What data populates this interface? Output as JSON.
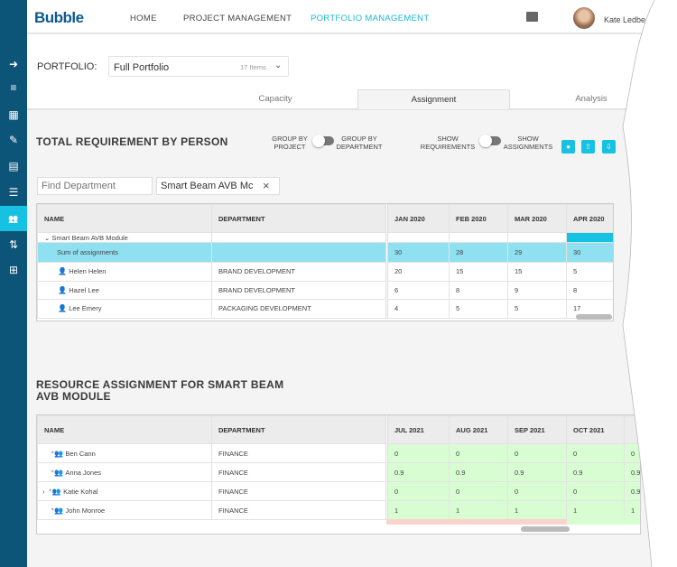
{
  "header": {
    "logo": "Bubble",
    "nav": [
      "HOME",
      "PROJECT MANAGEMENT",
      "PORTFOLIO MANAGEMENT"
    ],
    "active_nav": "PORTFOLIO MANAGEMENT",
    "user_name": "Kate Ledbe"
  },
  "sidebar": {
    "items": [
      "arrow-right-icon",
      "playlist-icon",
      "dashboard-icon",
      "edit-note-icon",
      "clipboard-icon",
      "list-icon",
      "people-icon",
      "sort-icon",
      "add-box-icon"
    ],
    "active_index": 6
  },
  "portfolio": {
    "label": "PORTFOLIO:",
    "selected": "Full Portfolio",
    "count": "17 Items"
  },
  "tabs": [
    "Capacity",
    "Assignment",
    "Analysis"
  ],
  "active_tab": "Assignment",
  "section1": {
    "title": "TOTAL REQUIREMENT BY PERSON",
    "toggle1": {
      "left": "GROUP BY PROJECT",
      "right": "GROUP BY DEPARTMENT"
    },
    "toggle2": {
      "left": "SHOW REQUIREMENTS",
      "right": "SHOW ASSIGNMENTS"
    },
    "find_placeholder": "Find Department",
    "filter_value": "Smart Beam AVB Mc",
    "columns": [
      "NAME",
      "DEPARTMENT",
      "JAN 2020",
      "FEB 2020",
      "MAR 2020",
      "APR 2020"
    ],
    "group": "Smart Beam AVB Module",
    "sum_row": {
      "name": "Sum of assignments",
      "values": [
        "30",
        "28",
        "29",
        "30"
      ]
    },
    "rows": [
      {
        "name": "Helen Helen",
        "department": "BRAND DEVELOPMENT",
        "values": [
          "20",
          "15",
          "15",
          "5"
        ]
      },
      {
        "name": "Hazel Lee",
        "department": "BRAND DEVELOPMENT",
        "values": [
          "6",
          "8",
          "9",
          "8"
        ]
      },
      {
        "name": "Lee Emery",
        "department": "PACKAGING DEVELOPMENT",
        "values": [
          "4",
          "5",
          "5",
          "17"
        ]
      }
    ]
  },
  "section2": {
    "title": "RESOURCE ASSIGNMENT FOR SMART BEAM AVB MODULE",
    "columns": [
      "NAME",
      "DEPARTMENT",
      "JUL 2021",
      "AUG 2021",
      "SEP 2021",
      "OCT 2021",
      ""
    ],
    "rows": [
      {
        "name": "Ben Cann",
        "department": "FINANCE",
        "values": [
          "0",
          "0",
          "0",
          "0",
          "0"
        ]
      },
      {
        "name": "Anna Jones",
        "department": "FINANCE",
        "values": [
          "0.9",
          "0.9",
          "0.9",
          "0.9",
          "0.9"
        ]
      },
      {
        "name": "Katie Kohal",
        "department": "FINANCE",
        "values": [
          "0",
          "0",
          "0",
          "0",
          "0.9"
        ],
        "expandable": true
      },
      {
        "name": "John Monroe",
        "department": "FINANCE",
        "values": [
          "1",
          "1",
          "1",
          "1",
          "1"
        ]
      }
    ]
  },
  "colors": {
    "sidebar": "#0d5479",
    "accent": "#16c1e2",
    "sum_row": "#8fe1f1",
    "assigned": "#d9fdd3",
    "over": "#fbd3cc"
  }
}
